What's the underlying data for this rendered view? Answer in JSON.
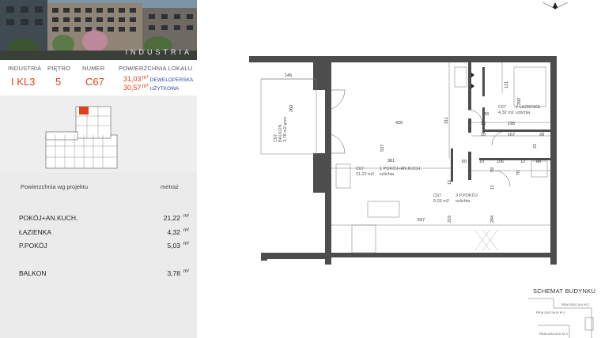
{
  "hero": {
    "brand": "INDUSTRIA"
  },
  "info": {
    "industria_label": "INDUSTRIA",
    "industria_value": "I KL3",
    "floor_label": "PIĘTRO",
    "floor_value": "5",
    "number_label": "NUMER",
    "number_value": "C67",
    "area_label": "POWIERZCHNIA LOKALU",
    "area_dev_value": "31,03",
    "area_dev_unit": "m²",
    "area_dev_tag": "DEWELOPERSKA",
    "area_use_value": "30,57",
    "area_use_unit": "m²",
    "area_use_tag": "UŻYTKOWA"
  },
  "summary": {
    "header": "Powierzchnia wg projektu",
    "unit_header": "metraż",
    "rooms": [
      {
        "name": "POKÓJ+AN.KUCH.",
        "value": "21,22",
        "unit": "m²"
      },
      {
        "name": "ŁAZIENKA",
        "value": "4,32",
        "unit": "m²"
      },
      {
        "name": "P.POKÓJ",
        "value": "5,03",
        "unit": "m²"
      }
    ],
    "balcony": {
      "name": "BALKON",
      "value": "3,78",
      "unit": "m²"
    }
  },
  "plan": {
    "dims": {
      "d145": "145",
      "d260": "260",
      "d420": "420",
      "d537a": "537",
      "d361": "361",
      "d311": "311",
      "d121": "121",
      "d292": "292",
      "d43": "43",
      "d10a": "10",
      "d195": "195",
      "d10b": "10",
      "d167": "167",
      "d28": "28",
      "d21": "21",
      "d60": "60",
      "d10c": "10",
      "d106": "106",
      "d12": "12",
      "d88": "88",
      "d59": "59",
      "d70": "70",
      "d11": "11",
      "d12b": "12",
      "d204": "204",
      "d537b": "537",
      "d215": "215"
    },
    "rooms": {
      "balcony_code": "C67",
      "balcony_name": "BALKON",
      "balcony_area": "3,78 m2 gres",
      "living_code": "C67",
      "living_name": "1 POKÓJ+AN.KUCH.",
      "living_area": "21,22 m2",
      "living_floor": "szlichta",
      "bath_code": "C67",
      "bath_name": "2 ŁAZIENKA",
      "bath_area": "4,32 m2",
      "bath_floor": "szlichta",
      "hall_code": "C67",
      "hall_name": "3 P.POKÓJ",
      "hall_area": "5,03 m2",
      "hall_floor": "szlichta"
    }
  },
  "scheme": {
    "title": "SCHEMAT BUDYNKU",
    "labels": [
      "REALIZACJA II KL2",
      "REALIZACJA III KL1",
      "REALIZACJA II KL3"
    ]
  },
  "colors": {
    "accent": "#e2401f",
    "tag": "#2f4a9e",
    "wall": "#4d4d4d"
  }
}
